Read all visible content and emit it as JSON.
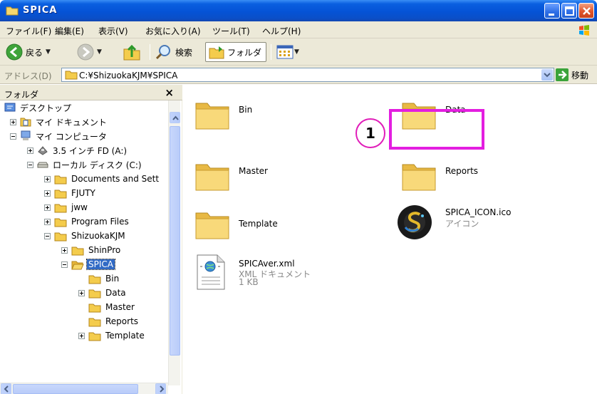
{
  "window": {
    "title": "SPICA"
  },
  "menu": [
    "ファイル(F)",
    "編集(E)",
    "表示(V)",
    "お気に入り(A)",
    "ツール(T)",
    "ヘルプ(H)"
  ],
  "toolbar": {
    "back": "戻る",
    "search": "検索",
    "folders": "フォルダ"
  },
  "address": {
    "label": "アドレス(D)",
    "path": "C:¥ShizuokaKJM¥SPICA",
    "go": "移動"
  },
  "folder_pane": {
    "title": "フォルダ",
    "close": "×",
    "tree": [
      "デスクトップ",
      "マイ ドキュメント",
      "マイ コンピュータ",
      "3.5 インチ FD (A:)",
      "ローカル ディスク (C:)",
      "Documents and Sett",
      "FJUTY",
      "jww",
      "Program Files",
      "ShizuokaKJM",
      "ShinPro",
      "SPICA",
      "Bin",
      "Data",
      "Master",
      "Reports",
      "Template"
    ]
  },
  "content": {
    "items": [
      {
        "name": "Bin"
      },
      {
        "name": "Data"
      },
      {
        "name": "Master"
      },
      {
        "name": "Reports"
      },
      {
        "name": "Template"
      },
      {
        "name": "SPICA_ICON.ico",
        "type": "アイコン"
      },
      {
        "name": "SPICAver.xml",
        "type": "XML ドキュメント",
        "size": "1 KB"
      }
    ]
  },
  "callout": {
    "number": "1"
  },
  "colors": {
    "callout": "#e31ee0",
    "titlebar": "#0553d6",
    "selection": "#316ac5"
  }
}
